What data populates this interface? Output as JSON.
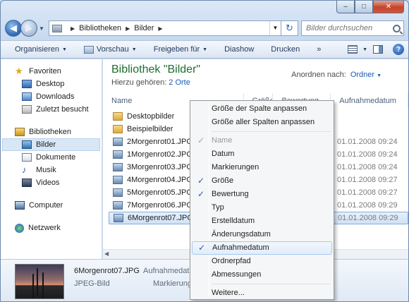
{
  "window": {
    "caption": {
      "minimize": "–",
      "maximize": "□",
      "close": "✕"
    }
  },
  "address": {
    "segments": [
      "Bibliotheken",
      "Bilder"
    ],
    "search_placeholder": "Bilder durchsuchen"
  },
  "toolbar": {
    "organize": "Organisieren",
    "preview": "Vorschau",
    "share": "Freigeben für",
    "slideshow": "Diashow",
    "print": "Drucken",
    "more": "»"
  },
  "nav": {
    "favorites": "Favoriten",
    "desktop": "Desktop",
    "downloads": "Downloads",
    "recent": "Zuletzt besucht",
    "libraries": "Bibliotheken",
    "pictures": "Bilder",
    "documents": "Dokumente",
    "music": "Musik",
    "videos": "Videos",
    "computer": "Computer",
    "network": "Netzwerk"
  },
  "main": {
    "title": "Bibliothek \"Bilder\"",
    "subtitle": "Hierzu gehören:",
    "locations": "2 Orte",
    "arrange_label": "Anordnen nach:",
    "arrange_value": "Ordner",
    "columns": [
      "Name",
      "Größe",
      "Bewertung",
      "Aufnahmedatum"
    ],
    "files": [
      {
        "name": "Desktopbilder",
        "date": ""
      },
      {
        "name": "Beispielbilder",
        "date": ""
      },
      {
        "name": "2Morgenrot01.JPG",
        "date": "01.01.2008 09:24"
      },
      {
        "name": "1Morgenrot02.JPG",
        "date": "01.01.2008 09:24"
      },
      {
        "name": "3Morgenrot03.JPG",
        "date": "01.01.2008 09:24"
      },
      {
        "name": "4Morgenrot04.JPG",
        "date": "01.01.2008 09:27"
      },
      {
        "name": "5Morgenrot05.JPG",
        "date": "01.01.2008 09:27"
      },
      {
        "name": "7Morgenrot06.JPG",
        "date": "01.01.2008 09:29"
      },
      {
        "name": "6Morgenrot07.JPG",
        "date": "01.01.2008 09:29"
      }
    ]
  },
  "details": {
    "filename": "6Morgenrot07.JPG",
    "field1": "Aufnahmedat",
    "type": "JPEG-Bild",
    "field2": "Markierung"
  },
  "context_menu": {
    "items": [
      {
        "label": "Größe der Spalte anpassen",
        "checked": false,
        "disabled": false
      },
      {
        "label": "Größe aller Spalten anpassen",
        "checked": false,
        "disabled": false
      },
      {
        "label": "---"
      },
      {
        "label": "Name",
        "checked": true,
        "disabled": true
      },
      {
        "label": "Datum",
        "checked": false,
        "disabled": false
      },
      {
        "label": "Markierungen",
        "checked": false,
        "disabled": false
      },
      {
        "label": "Größe",
        "checked": true,
        "disabled": false
      },
      {
        "label": "Bewertung",
        "checked": true,
        "disabled": false
      },
      {
        "label": "Typ",
        "checked": false,
        "disabled": false
      },
      {
        "label": "Erstelldatum",
        "checked": false,
        "disabled": false
      },
      {
        "label": "Änderungsdatum",
        "checked": false,
        "disabled": false
      },
      {
        "label": "Aufnahmedatum",
        "checked": true,
        "disabled": false,
        "highlighted": true
      },
      {
        "label": "Ordnerpfad",
        "checked": false,
        "disabled": false
      },
      {
        "label": "Abmessungen",
        "checked": false,
        "disabled": false
      },
      {
        "label": "---"
      },
      {
        "label": "Weitere...",
        "checked": false,
        "disabled": false
      }
    ],
    "check_glyph": "✓"
  }
}
